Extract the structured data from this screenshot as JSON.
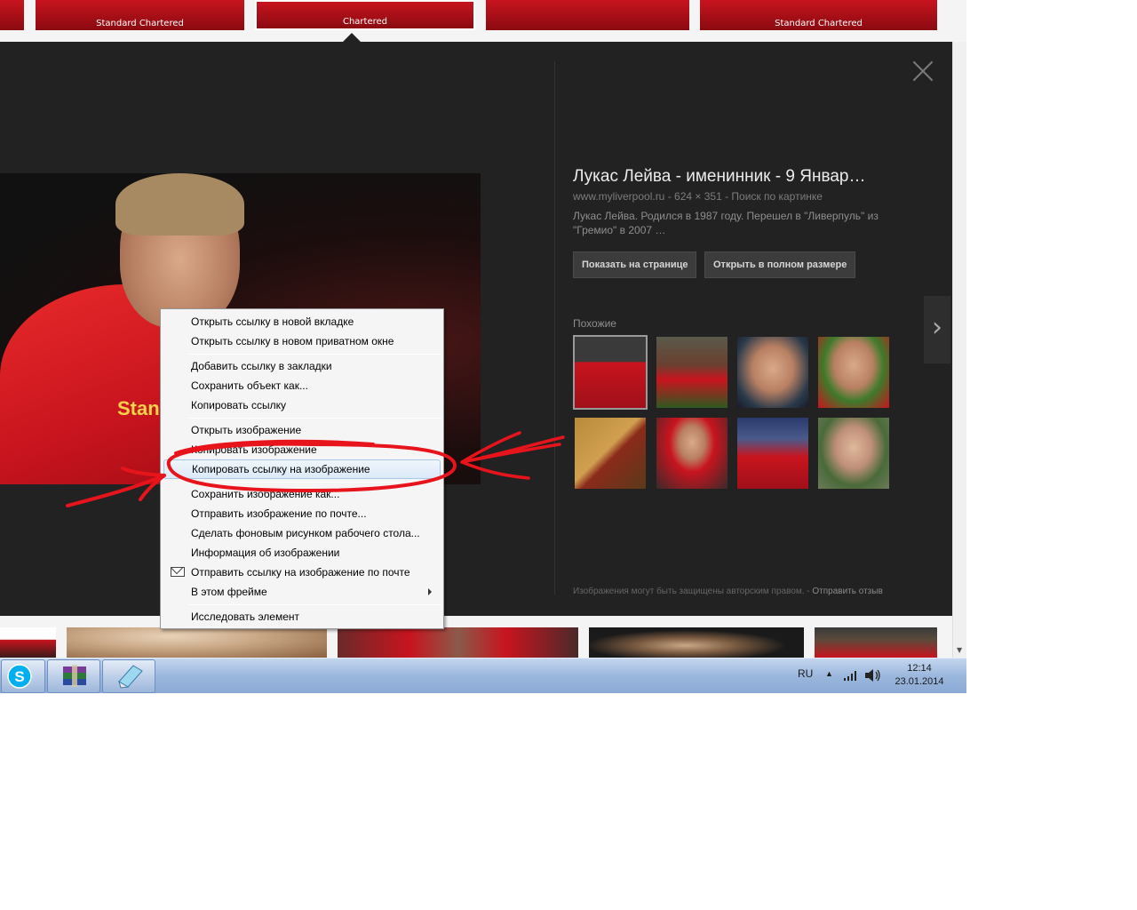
{
  "top_thumbnails": [
    {
      "caption": ""
    },
    {
      "caption": "Standard Chartered"
    },
    {
      "caption": "Chartered"
    },
    {
      "caption": ""
    },
    {
      "caption": "Standard Chartered"
    }
  ],
  "viewer": {
    "title": "Лукас Лейва - именинник - 9 Январ…",
    "meta": "www.myliverpool.ru - 624 × 351 - Поиск по картинке",
    "description": "Лукас Лейва. Родился в 1987 году. Перешел в \"Ливерпуль\" из \"Гремио\" в 2007 …",
    "btn_show_on_page": "Показать на странице",
    "btn_open_full": "Открыть в полном размере",
    "similar_label": "Похожие",
    "footer_note": "Изображения могут быть защищены авторским правом.",
    "footer_link": "Отправить отзыв",
    "photo_text": "Stan Char"
  },
  "context_menu": {
    "open_new_tab": "Открыть ссылку в новой вкладке",
    "open_private": "Открыть ссылку в новом приватном окне",
    "bookmark_link": "Добавить ссылку в закладки",
    "save_object": "Сохранить объект как...",
    "copy_link": "Копировать ссылку",
    "open_image": "Открыть изображение",
    "copy_image": "Копировать изображение",
    "copy_image_link": "Копировать ссылку на изображение",
    "save_image": "Сохранить изображение как...",
    "email_image": "Отправить изображение по почте...",
    "set_background": "Сделать фоновым рисунком рабочего стола...",
    "image_info": "Информация об изображении",
    "email_image_link": "Отправить ссылку на изображение по почте",
    "in_this_frame": "В этом фрейме",
    "inspect_element": "Исследовать элемент"
  },
  "taskbar": {
    "language": "RU",
    "time": "12:14",
    "date": "23.01.2014"
  },
  "colors": {
    "viewer_bg": "#222222",
    "annotation_red": "#e8141c",
    "menu_highlight": "#dbe9f8"
  }
}
